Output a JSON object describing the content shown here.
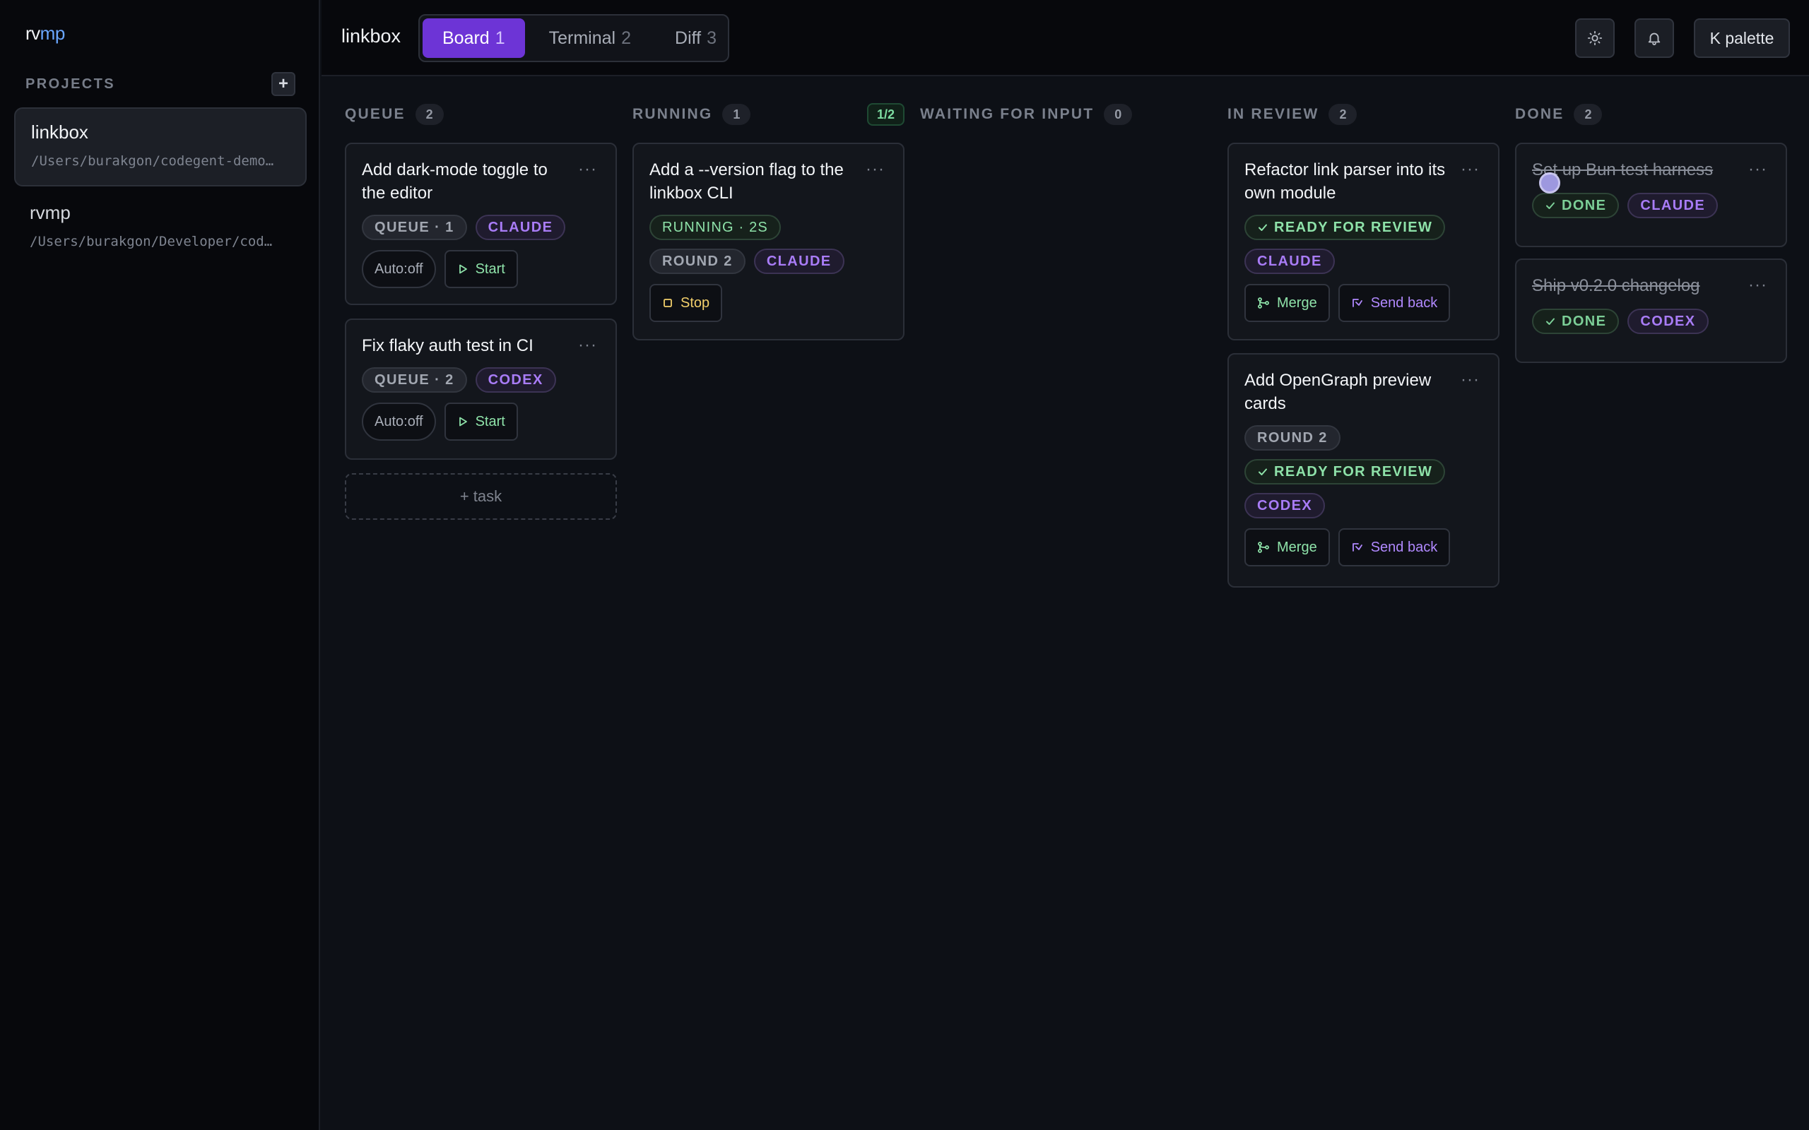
{
  "app": {
    "brand_left": "rv",
    "brand_right": "mp"
  },
  "sidebar": {
    "projects_label": "PROJECTS",
    "add_label": "+",
    "projects": [
      {
        "name": "linkbox",
        "path": "/Users/burakgon/codegent-demo…"
      },
      {
        "name": "rvmp",
        "path": "/Users/burakgon/Developer/cod…"
      }
    ]
  },
  "topbar": {
    "project_title": "linkbox",
    "tabs": [
      {
        "label": "Board",
        "count": "1"
      },
      {
        "label": "Terminal",
        "count": "2"
      },
      {
        "label": "Diff",
        "count": "3"
      }
    ],
    "theme_icon": "sun-icon",
    "notify_icon": "bell-icon",
    "palette_label": "K palette"
  },
  "columns": {
    "queue": {
      "title": "QUEUE",
      "count": "2",
      "cards": [
        {
          "title": "Add dark-mode toggle to the editor",
          "status": "QUEUE · 1",
          "agent": "CLAUDE",
          "auto": "Auto:off",
          "start": "Start"
        },
        {
          "title": "Fix flaky auth test in CI",
          "status": "QUEUE · 2",
          "agent": "CODEX",
          "auto": "Auto:off",
          "start": "Start"
        }
      ],
      "add_task": "+ task"
    },
    "running": {
      "title": "RUNNING",
      "count": "1",
      "slots": "1/2",
      "cards": [
        {
          "title": "Add a --version flag to the linkbox CLI",
          "status": "RUNNING · 2S",
          "round": "ROUND 2",
          "agent": "CLAUDE",
          "stop": "Stop"
        }
      ]
    },
    "waiting": {
      "title": "WAITING FOR INPUT",
      "count": "0"
    },
    "review": {
      "title": "IN REVIEW",
      "count": "2",
      "cards": [
        {
          "title": "Refactor link parser into its own module",
          "ready": "READY FOR REVIEW",
          "agent": "CLAUDE",
          "merge": "Merge",
          "send_back": "Send back"
        },
        {
          "title": "Add OpenGraph preview cards",
          "round": "ROUND 2",
          "ready": "READY FOR REVIEW",
          "agent": "CODEX",
          "merge": "Merge",
          "send_back": "Send back"
        }
      ]
    },
    "done": {
      "title": "DONE",
      "count": "2",
      "cards": [
        {
          "title": "Set up Bun test harness",
          "status": "DONE",
          "agent": "CLAUDE"
        },
        {
          "title": "Ship v0.2.0 changelog",
          "status": "DONE",
          "agent": "CODEX"
        }
      ]
    }
  },
  "card_menu_glyph": "···",
  "colors": {
    "accent": "#6d34d6",
    "agent": "#a97cf7",
    "success": "#8ee2a9",
    "warning": "#f2cf6b",
    "background": "#0d1016",
    "sidebar": "#07080c"
  }
}
